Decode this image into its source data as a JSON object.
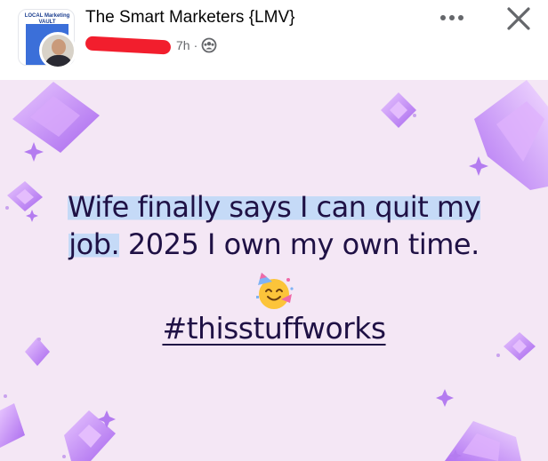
{
  "header": {
    "group_name": "The Smart Marketers {LMV}",
    "group_avatar_text": "LOCAL Marketing VAULT",
    "timestamp": "7h",
    "separator": "·",
    "privacy_icon": "group-icon",
    "more_icon": "more-dots-icon",
    "close_icon": "close-icon"
  },
  "post": {
    "line1": "Wife finally says I can quit my",
    "line2_highlight": "job.",
    "line2_rest": " 2025 I own my own time.",
    "emoji": "partying-face-emoji",
    "hashtag": "#thisstuffworks",
    "background_color": "#f4e7f5",
    "highlight_color": "#c5daf7",
    "text_color": "#1f1145",
    "accent_color": "#b47cf0"
  }
}
